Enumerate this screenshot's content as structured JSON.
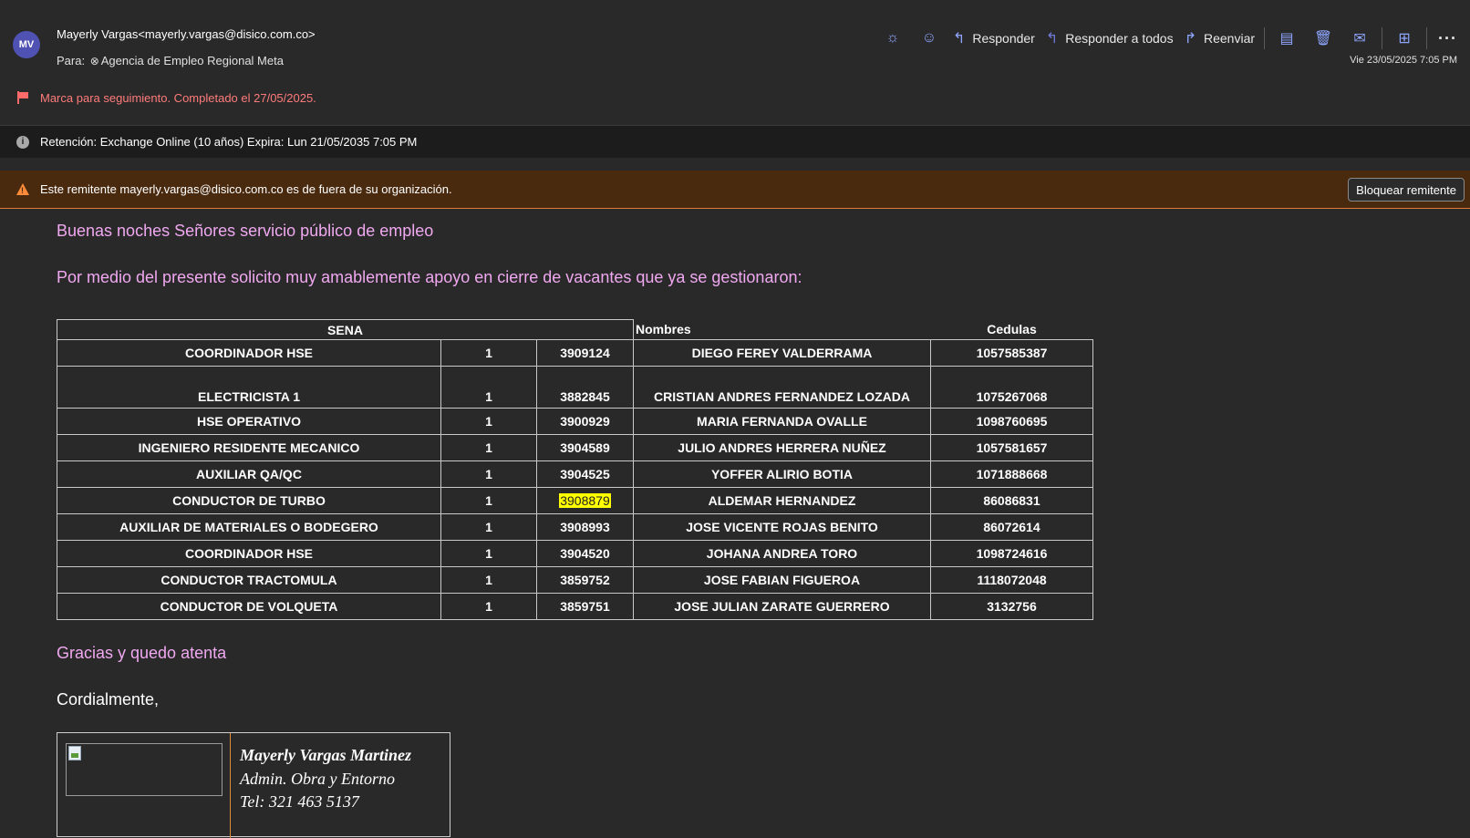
{
  "header": {
    "avatar_initials": "MV",
    "from": "Mayerly Vargas<mayerly.vargas@disico.com.co>",
    "to_label": "Para:",
    "to_recipient": "Agencia de Empleo Regional Meta",
    "date": "Vie 23/05/2025 7:05 PM",
    "toolbar": {
      "reply": "Responder",
      "reply_all": "Responder a todos",
      "forward": "Reenviar",
      "more": "···"
    }
  },
  "flag": {
    "text": "Marca para seguimiento. Completado el 27/05/2025."
  },
  "retention": {
    "text": "Retención: Exchange Online (10 años) Expira: Lun 21/05/2035 7:05 PM"
  },
  "warning": {
    "text": "Este remitente mayerly.vargas@disico.com.co es de fuera de su organización.",
    "block_button": "Bloquear remitente"
  },
  "body": {
    "greeting": "Buenas noches Señores servicio público de empleo",
    "intro": "Por medio del presente solicito muy amablemente apoyo en cierre de vacantes que ya se gestionaron:",
    "thanks": "Gracias y quedo atenta",
    "closing": "Cordialmente,"
  },
  "table": {
    "headers": {
      "sena": "SENA",
      "nombres": "Nombres",
      "cedulas": "Cedulas"
    },
    "rows": [
      {
        "cargo": "COORDINADOR HSE",
        "cant": "1",
        "codigo": "3909124",
        "nombre": "DIEGO FEREY VALDERRAMA",
        "cedula": "1057585387"
      },
      {
        "cargo": "ELECTRICISTA 1",
        "cant": "1",
        "codigo": "3882845",
        "nombre": "CRISTIAN ANDRES FERNANDEZ LOZADA",
        "cedula": "1075267068"
      },
      {
        "cargo": "HSE OPERATIVO",
        "cant": "1",
        "codigo": "3900929",
        "nombre": "MARIA FERNANDA OVALLE",
        "cedula": "1098760695"
      },
      {
        "cargo": "INGENIERO RESIDENTE MECANICO",
        "cant": "1",
        "codigo": "3904589",
        "nombre": "JULIO ANDRES HERRERA NUÑEZ",
        "cedula": "1057581657"
      },
      {
        "cargo": "AUXILIAR QA/QC",
        "cant": "1",
        "codigo": "3904525",
        "nombre": "YOFFER ALIRIO BOTIA",
        "cedula": "1071888668"
      },
      {
        "cargo": "CONDUCTOR DE TURBO",
        "cant": "1",
        "codigo": "3908879",
        "nombre": "ALDEMAR HERNANDEZ",
        "cedula": "86086831"
      },
      {
        "cargo": "AUXILIAR DE MATERIALES O BODEGERO",
        "cant": "1",
        "codigo": "3908993",
        "nombre": "JOSE VICENTE ROJAS BENITO",
        "cedula": "86072614"
      },
      {
        "cargo": "COORDINADOR HSE",
        "cant": "1",
        "codigo": "3904520",
        "nombre": "JOHANA ANDREA TORO",
        "cedula": "1098724616"
      },
      {
        "cargo": "CONDUCTOR TRACTOMULA",
        "cant": "1",
        "codigo": "3859752",
        "nombre": "JOSE FABIAN FIGUEROA",
        "cedula": "1118072048"
      },
      {
        "cargo": "CONDUCTOR DE VOLQUETA",
        "cant": "1",
        "codigo": "3859751",
        "nombre": "JOSE JULIAN ZARATE GUERRERO",
        "cedula": "3132756"
      }
    ]
  },
  "signature": {
    "name": "Mayerly Vargas Martinez",
    "role": "Admin. Obra y Entorno",
    "tel": "Tel: 321 463 5137"
  }
}
